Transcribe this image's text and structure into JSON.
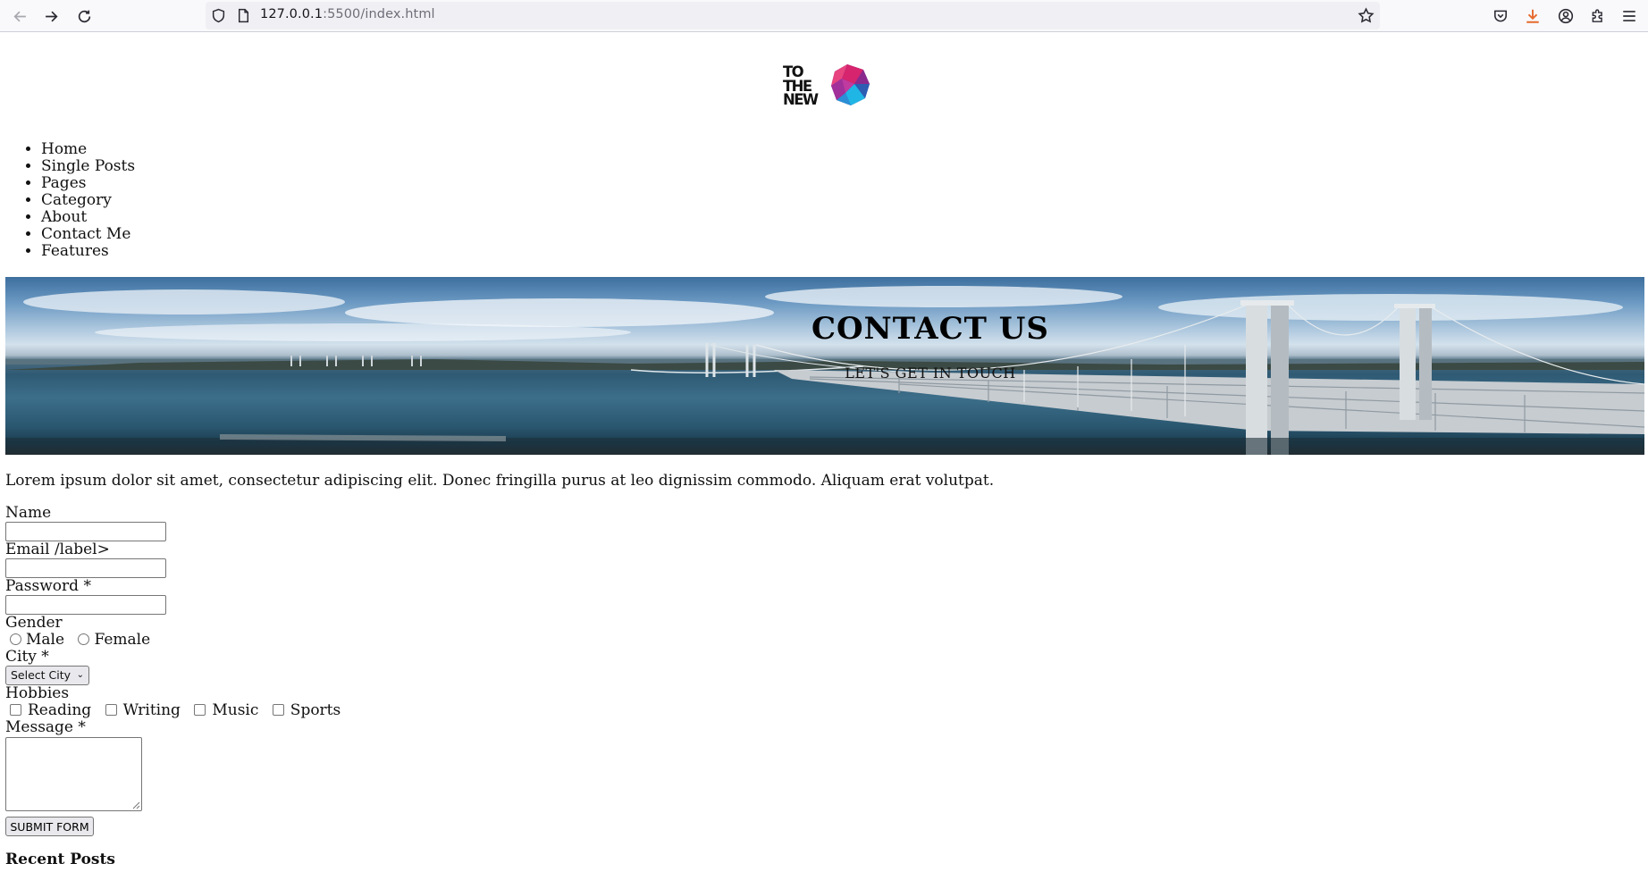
{
  "browser": {
    "url_host": "127.0.0.1",
    "url_rest": ":5500/index.html"
  },
  "logo": {
    "line1": "TO",
    "line2": "THE",
    "line3": "NEW"
  },
  "nav": {
    "items": [
      "Home",
      "Single Posts",
      "Pages",
      "Category",
      "About",
      "Contact Me",
      "Features"
    ]
  },
  "hero": {
    "title": "CONTACT US",
    "subtitle": "LET'S GET IN TOUCH"
  },
  "intro_text": "Lorem ipsum dolor sit amet, consectetur adipiscing elit. Donec fringilla purus at leo dignissim commodo. Aliquam erat volutpat.",
  "form": {
    "name_label": "Name",
    "name_value": "",
    "email_label": "Email /label>",
    "email_value": "",
    "password_label": "Password *",
    "password_value": "",
    "gender_label": "Gender",
    "gender_options": [
      "Male",
      "Female"
    ],
    "city_label": "City *",
    "city_selected": "Select City",
    "hobbies_label": "Hobbies",
    "hobby_options": [
      "Reading",
      "Writing",
      "Music",
      "Sports"
    ],
    "message_label": "Message *",
    "message_value": "",
    "submit_label": "SUBMIT FORM"
  },
  "recent_posts_heading": "Recent Posts",
  "icons": {
    "back": "arrow-left-icon",
    "forward": "arrow-right-icon",
    "reload": "reload-icon",
    "shield": "shield-icon",
    "page": "page-icon",
    "bookmark": "star-icon",
    "pocket": "pocket-icon",
    "downloads": "download-icon",
    "account": "account-icon",
    "extensions": "puzzle-icon",
    "menu": "hamburger-menu-icon"
  },
  "colors": {
    "download_accent": "#e66a2c",
    "logo_pink": "#d6246e",
    "logo_blue": "#2d5db3",
    "logo_cyan": "#1fb6e6"
  }
}
